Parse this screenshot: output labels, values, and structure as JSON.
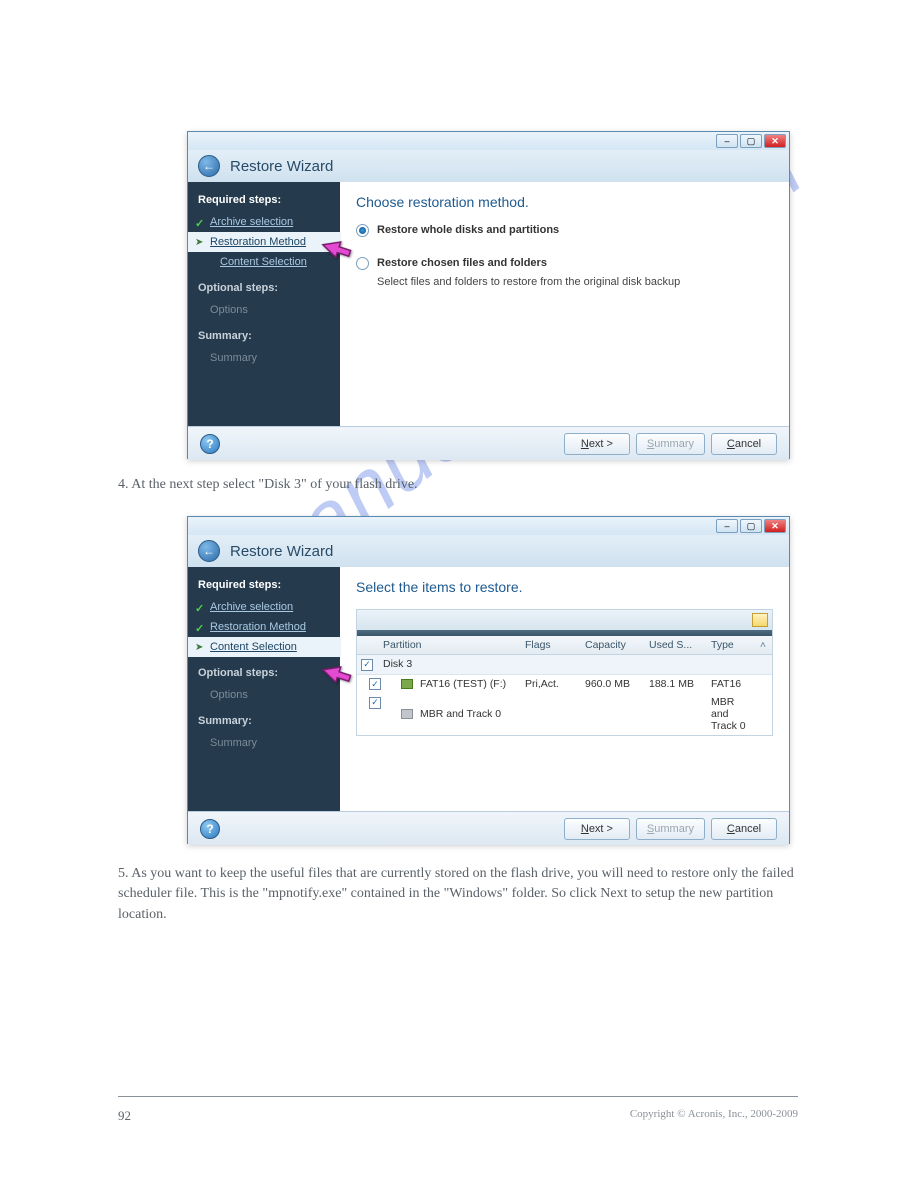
{
  "watermark": "manualshive.com",
  "page_number": "92",
  "copyright": "Copyright © Acronis, Inc., 2000-2009",
  "step_after1": "4. At the next step select \"Disk 3\" of your flash drive.",
  "step_after2": "5. As you want to keep the useful files that are currently stored on the flash drive, you will need to restore only the failed scheduler file. This is the \"mpnotify.exe\" contained in the \"Windows\" folder. So click Next to setup the new partition location.",
  "wizard": {
    "title": "Restore Wizard",
    "sidebar": {
      "required_header": "Required steps:",
      "archive_selection": "Archive selection",
      "restoration_method": "Restoration Method",
      "content_selection": "Content Selection",
      "optional_header": "Optional steps:",
      "options": "Options",
      "summary_header": "Summary:",
      "summary": "Summary"
    },
    "footer": {
      "next": "Next >",
      "summary": "Summary",
      "cancel": "Cancel"
    }
  },
  "panel1": {
    "heading": "Choose restoration method.",
    "opt1_label": "Restore whole disks and partitions",
    "opt2_label": "Restore chosen files and folders",
    "opt2_desc": "Select files and folders to restore from the original disk backup"
  },
  "panel2": {
    "heading": "Select the items to restore.",
    "columns": {
      "partition": "Partition",
      "flags": "Flags",
      "capacity": "Capacity",
      "used": "Used S...",
      "type": "Type"
    },
    "disk_label": "Disk 3",
    "rows": [
      {
        "name": "FAT16 (TEST) (F:)",
        "flags": "Pri,Act.",
        "capacity": "960.0 MB",
        "used": "188.1 MB",
        "type": "FAT16"
      },
      {
        "name": "MBR and Track 0",
        "flags": "",
        "capacity": "",
        "used": "",
        "type": "MBR and Track 0"
      }
    ]
  }
}
